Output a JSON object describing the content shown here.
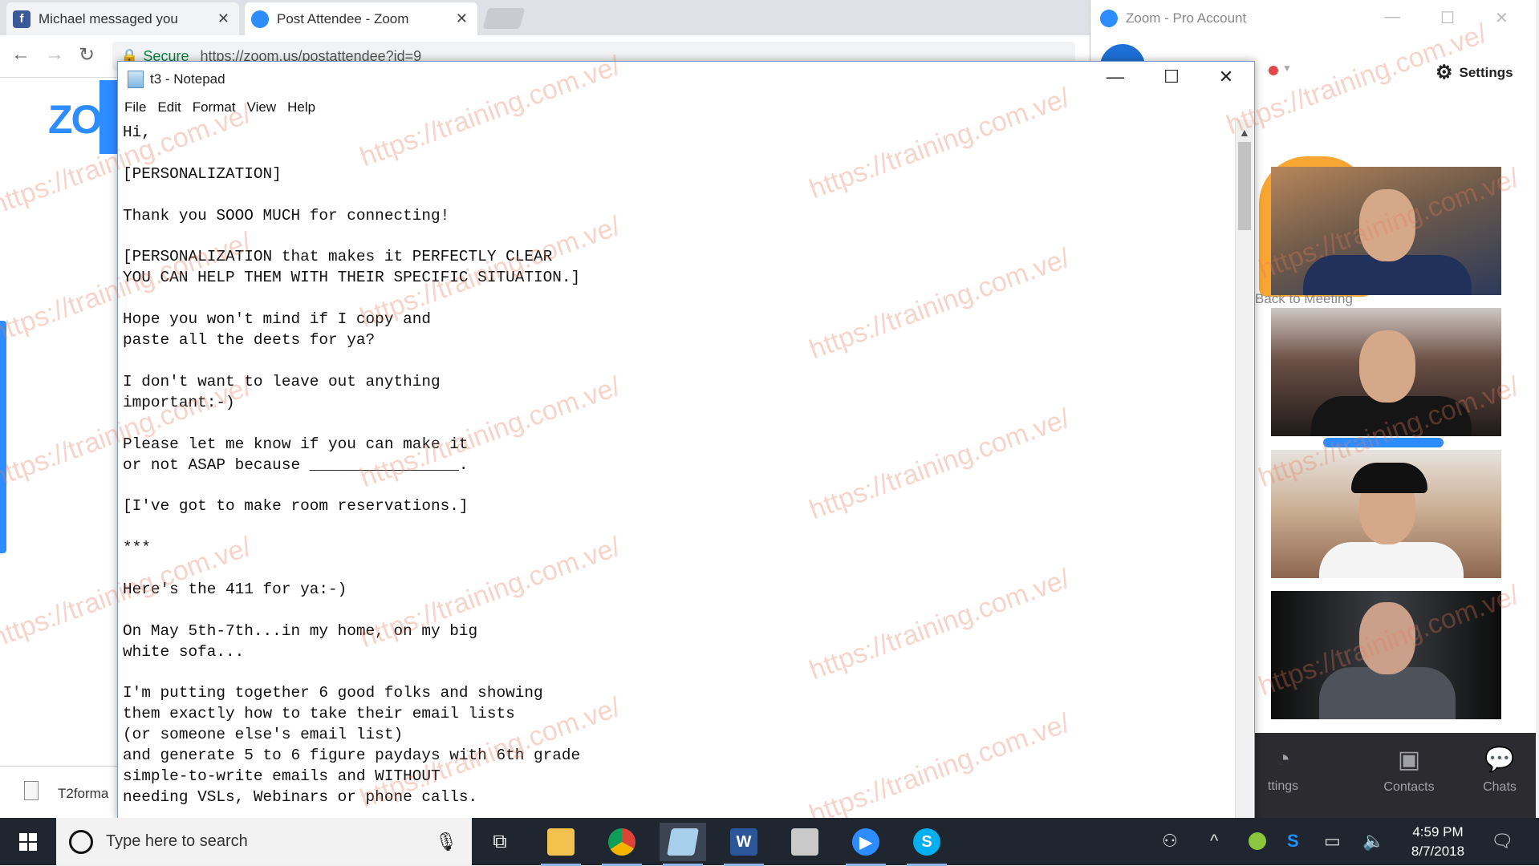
{
  "browser": {
    "tabs": [
      {
        "label": "Michael messaged you",
        "icon": "facebook-icon",
        "active": false
      },
      {
        "label": "Post Attendee - Zoom",
        "icon": "zoom-icon",
        "active": true
      }
    ],
    "address": {
      "secure_label": "Secure",
      "url": "https://zoom.us/postattendee?id=9"
    },
    "zoom_logo_partial": "ZO",
    "download": {
      "filename": "T2forma"
    }
  },
  "zoom_window": {
    "title": "Zoom - Pro Account",
    "settings_label": "Settings",
    "back_to_meeting": "Back to Meeting",
    "footer": [
      {
        "label": "ttings",
        "icon": "meetings-icon"
      },
      {
        "label": "Contacts",
        "icon": "contacts-icon"
      },
      {
        "label": "Chats",
        "icon": "chats-icon"
      }
    ]
  },
  "notepad": {
    "title": "t3 - Notepad",
    "menu": [
      "File",
      "Edit",
      "Format",
      "View",
      "Help"
    ],
    "content": "Hi,\n\n[PERSONALIZATION]\n\nThank you SOOO MUCH for connecting!\n\n[PERSONALIZATION that makes it PERFECTLY CLEAR\nYOU CAN HELP THEM WITH THEIR SPECIFIC SITUATION.]\n\nHope you won't mind if I copy and\npaste all the deets for ya?\n\nI don't want to leave out anything\nimportant:-)\n\nPlease let me know if you can make it\nor not ASAP because ________________.\n\n[I've got to make room reservations.]\n\n***\n\nHere's the 411 for ya:-)\n\nOn May 5th-7th...in my home, on my big\nwhite sofa...\n\nI'm putting together 6 good folks and showing\nthem exactly how to take their email lists\n(or someone else's email list)\nand generate 5 to 6 figure paydays with 6th grade\nsimple-to-write emails and WITHOUT\nneeding VSLs, Webinars or phone calls."
  },
  "watermark": "https://training.com.ve/",
  "taskbar": {
    "search_placeholder": "Type here to search",
    "time": "4:59 PM",
    "date": "8/7/2018"
  },
  "colors": {
    "zoom_blue": "#2d8cff",
    "taskbar": "#1f2630",
    "watermark": "#e6785a"
  }
}
